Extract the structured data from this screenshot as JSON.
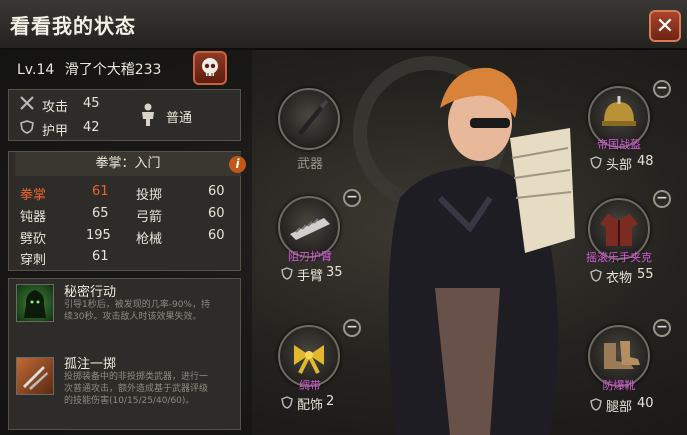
{
  "title": "看看我的状态",
  "close_label": "✕",
  "player": {
    "level": "Lv.14",
    "name": "滑了个大稽233"
  },
  "defense": {
    "attack_label": "攻击",
    "attack_value": "45",
    "armor_label": "护甲",
    "armor_value": "42",
    "stance_label": "普通"
  },
  "skills": {
    "title": "拳掌：入门",
    "rows": [
      {
        "name": "拳掌",
        "value": "61",
        "name2": "投掷",
        "value2": "60"
      },
      {
        "name": "钝器",
        "value": "65",
        "name2": "弓箭",
        "value2": "60"
      },
      {
        "name": "劈砍",
        "value": "195",
        "name2": "枪械",
        "value2": "60"
      },
      {
        "name": "穿刺",
        "value": "61"
      }
    ]
  },
  "abilities": [
    {
      "name": "秘密行动",
      "desc1": "引导1秒后，被发现的几率-90%，持",
      "desc2": "续30秒。攻击敌人时该效果失效。"
    },
    {
      "name": "孤注一掷",
      "desc1": "投掷装备中的非投掷类武器，进行一",
      "desc2": "次普通攻击，额外造成基于武器评级",
      "desc3": "的技能伤害(10/15/25/40/60)。"
    }
  ],
  "slots": {
    "weapon": {
      "label": "武器"
    },
    "arm": {
      "item": "阻刃护臂",
      "label": "手臂",
      "value": "35"
    },
    "accessory": {
      "item": "绸带",
      "label": "配饰",
      "value": "2"
    },
    "head": {
      "item": "帝国战盔",
      "label": "头部",
      "value": "48"
    },
    "clothes": {
      "item": "摇滚乐手夹克",
      "label": "衣物",
      "value": "55"
    },
    "legs": {
      "item": "防爆靴",
      "label": "腿部",
      "value": "40"
    }
  },
  "colors": {
    "item_name": "#d35ad9",
    "skill_highlight": "#e8652a",
    "button_red": "#8e3a24"
  }
}
